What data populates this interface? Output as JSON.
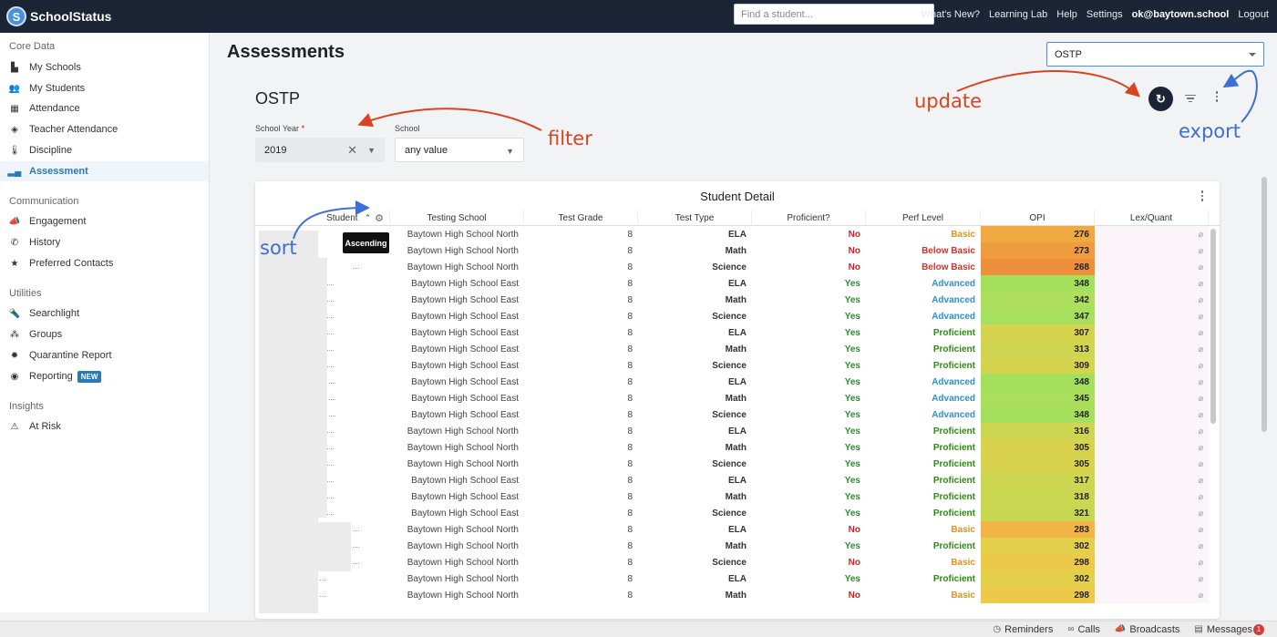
{
  "header": {
    "brand": "SchoolStatus",
    "brand_logo_letter": "S",
    "search_placeholder": "Find a student...",
    "nav": [
      "What's New?",
      "Learning Lab",
      "Help",
      "Settings"
    ],
    "user": "ok@baytown.school",
    "logout": "Logout"
  },
  "sidebar": {
    "sections": [
      {
        "title": "Core Data",
        "items": [
          {
            "label": "My Schools",
            "icon": "building-icon"
          },
          {
            "label": "My Students",
            "icon": "users-icon"
          },
          {
            "label": "Attendance",
            "icon": "calendar-icon"
          },
          {
            "label": "Teacher Attendance",
            "icon": "ticket-icon"
          },
          {
            "label": "Discipline",
            "icon": "thermometer-icon"
          },
          {
            "label": "Assessment",
            "icon": "chart-icon",
            "active": true
          }
        ]
      },
      {
        "title": "Communication",
        "items": [
          {
            "label": "Engagement",
            "icon": "megaphone-icon"
          },
          {
            "label": "History",
            "icon": "phone-icon"
          },
          {
            "label": "Preferred Contacts",
            "icon": "star-icon"
          }
        ]
      },
      {
        "title": "Utilities",
        "items": [
          {
            "label": "Searchlight",
            "icon": "flashlight-icon"
          },
          {
            "label": "Groups",
            "icon": "group-icon"
          },
          {
            "label": "Quarantine Report",
            "icon": "virus-icon"
          },
          {
            "label": "Reporting",
            "icon": "report-icon",
            "badge": "NEW"
          }
        ]
      },
      {
        "title": "Insights",
        "items": [
          {
            "label": "At Risk",
            "icon": "risk-icon"
          }
        ]
      }
    ]
  },
  "main": {
    "page_title": "Assessments",
    "assessment_select": "OSTP",
    "section_title": "OSTP",
    "filters": {
      "year_label": "School Year",
      "year_required": "*",
      "year_value": "2019",
      "school_label": "School",
      "school_value": "any value"
    },
    "annotations": {
      "update": "update",
      "filter": "filter",
      "export": "export",
      "sort": "sort"
    },
    "table": {
      "title": "Student Detail",
      "tooltip": "Ascending",
      "columns": [
        "Student",
        "Testing School",
        "Test Grade",
        "Test Type",
        "Proficient?",
        "Perf Level",
        "OPI",
        "Lex/Quant"
      ],
      "rows": [
        {
          "school": "Baytown High School North",
          "grade": "8",
          "type": "ELA",
          "prof": "No",
          "perf": "Basic",
          "opi": "276",
          "color": "#f0a840"
        },
        {
          "school": "Baytown High School North",
          "grade": "8",
          "type": "Math",
          "prof": "No",
          "perf": "Below Basic",
          "opi": "273",
          "color": "#ef9c3e"
        },
        {
          "school": "Baytown High School North",
          "grade": "8",
          "type": "Science",
          "prof": "No",
          "perf": "Below Basic",
          "opi": "268",
          "color": "#ee8f3b"
        },
        {
          "school": "Baytown High School East",
          "grade": "8",
          "type": "ELA",
          "prof": "Yes",
          "perf": "Advanced",
          "opi": "348",
          "color": "#a5e05c"
        },
        {
          "school": "Baytown High School East",
          "grade": "8",
          "type": "Math",
          "prof": "Yes",
          "perf": "Advanced",
          "opi": "342",
          "color": "#aedf5c"
        },
        {
          "school": "Baytown High School East",
          "grade": "8",
          "type": "Science",
          "prof": "Yes",
          "perf": "Advanced",
          "opi": "347",
          "color": "#a7e05c"
        },
        {
          "school": "Baytown High School East",
          "grade": "8",
          "type": "ELA",
          "prof": "Yes",
          "perf": "Proficient",
          "opi": "307",
          "color": "#d6d34e"
        },
        {
          "school": "Baytown High School East",
          "grade": "8",
          "type": "Math",
          "prof": "Yes",
          "perf": "Proficient",
          "opi": "313",
          "color": "#d0d54f"
        },
        {
          "school": "Baytown High School East",
          "grade": "8",
          "type": "Science",
          "prof": "Yes",
          "perf": "Proficient",
          "opi": "309",
          "color": "#d4d44e"
        },
        {
          "school": "Baytown High School East",
          "grade": "8",
          "type": "ELA",
          "prof": "Yes",
          "perf": "Advanced",
          "opi": "348",
          "color": "#a5e05c"
        },
        {
          "school": "Baytown High School East",
          "grade": "8",
          "type": "Math",
          "prof": "Yes",
          "perf": "Advanced",
          "opi": "345",
          "color": "#aadf5c"
        },
        {
          "school": "Baytown High School East",
          "grade": "8",
          "type": "Science",
          "prof": "Yes",
          "perf": "Advanced",
          "opi": "348",
          "color": "#a5e05c"
        },
        {
          "school": "Baytown High School North",
          "grade": "8",
          "type": "ELA",
          "prof": "Yes",
          "perf": "Proficient",
          "opi": "316",
          "color": "#cdd650"
        },
        {
          "school": "Baytown High School North",
          "grade": "8",
          "type": "Math",
          "prof": "Yes",
          "perf": "Proficient",
          "opi": "305",
          "color": "#d8d24d"
        },
        {
          "school": "Baytown High School North",
          "grade": "8",
          "type": "Science",
          "prof": "Yes",
          "perf": "Proficient",
          "opi": "305",
          "color": "#d8d24d"
        },
        {
          "school": "Baytown High School East",
          "grade": "8",
          "type": "ELA",
          "prof": "Yes",
          "perf": "Proficient",
          "opi": "317",
          "color": "#ccd650"
        },
        {
          "school": "Baytown High School East",
          "grade": "8",
          "type": "Math",
          "prof": "Yes",
          "perf": "Proficient",
          "opi": "318",
          "color": "#cbd651"
        },
        {
          "school": "Baytown High School East",
          "grade": "8",
          "type": "Science",
          "prof": "Yes",
          "perf": "Proficient",
          "opi": "321",
          "color": "#c8d752"
        },
        {
          "school": "Baytown High School North",
          "grade": "8",
          "type": "ELA",
          "prof": "No",
          "perf": "Basic",
          "opi": "283",
          "color": "#f2b445"
        },
        {
          "school": "Baytown High School North",
          "grade": "8",
          "type": "Math",
          "prof": "Yes",
          "perf": "Proficient",
          "opi": "302",
          "color": "#e3cf4a"
        },
        {
          "school": "Baytown High School North",
          "grade": "8",
          "type": "Science",
          "prof": "No",
          "perf": "Basic",
          "opi": "298",
          "color": "#ecc948"
        },
        {
          "school": "Baytown High School North",
          "grade": "8",
          "type": "ELA",
          "prof": "Yes",
          "perf": "Proficient",
          "opi": "302",
          "color": "#e3cf4a"
        },
        {
          "school": "Baytown High School North",
          "grade": "8",
          "type": "Math",
          "prof": "No",
          "perf": "Basic",
          "opi": "298",
          "color": "#ecc948"
        }
      ],
      "lex_symbol": "⌀"
    }
  },
  "bottom_bar": {
    "reminders": "Reminders",
    "calls": "Calls",
    "broadcasts": "Broadcasts",
    "messages": "Messages",
    "messages_count": "1"
  }
}
